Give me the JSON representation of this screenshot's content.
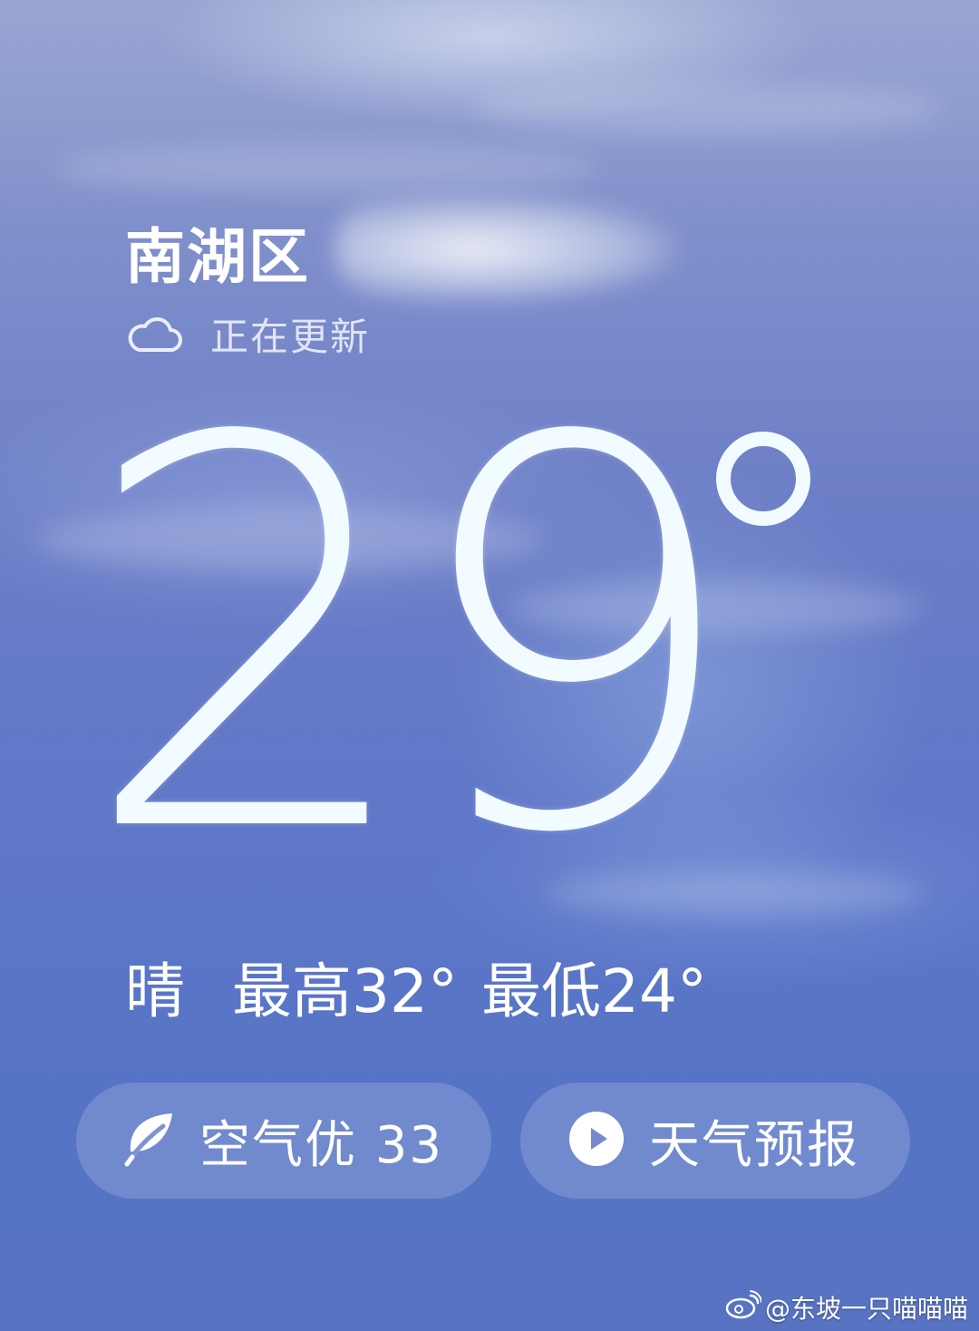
{
  "header": {
    "location": "南湖区",
    "status_text": "正在更新",
    "status_icon": "cloud-icon"
  },
  "current": {
    "temperature": "29",
    "condition": "晴",
    "high": "最高32°",
    "low": "最低24°"
  },
  "actions": {
    "air_quality_label": "空气优 33",
    "air_quality_icon": "leaf-icon",
    "forecast_label": "天气预报",
    "forecast_icon": "play-icon"
  },
  "watermark": {
    "text": "@东坡一只喵喵喵"
  },
  "colors": {
    "sky_top": "#9aa6d2",
    "sky_bottom": "#5773c2",
    "text": "#ffffff",
    "temperature": "#f2fbff"
  }
}
